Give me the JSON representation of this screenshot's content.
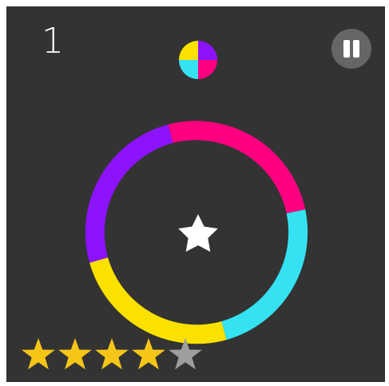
{
  "hud": {
    "score": "1",
    "pause_icon": "pause-icon"
  },
  "colors": {
    "background": "#333333",
    "yellow": "#FAE100",
    "purple": "#8C13FB",
    "pink": "#FF0080",
    "cyan": "#35E2F2",
    "pause_button": "#666666",
    "star": "#FFFFFF",
    "rating_filled": "#F5C518",
    "rating_empty": "#9E9E9E"
  },
  "obstacle": {
    "type": "circle",
    "segments": [
      "pink",
      "cyan",
      "yellow",
      "purple"
    ]
  },
  "color_switcher": {
    "quadrants": [
      "purple",
      "pink",
      "cyan",
      "yellow"
    ]
  },
  "player_star_icon": "star-icon",
  "rating": {
    "stars_filled": 4,
    "stars_total": 5
  }
}
